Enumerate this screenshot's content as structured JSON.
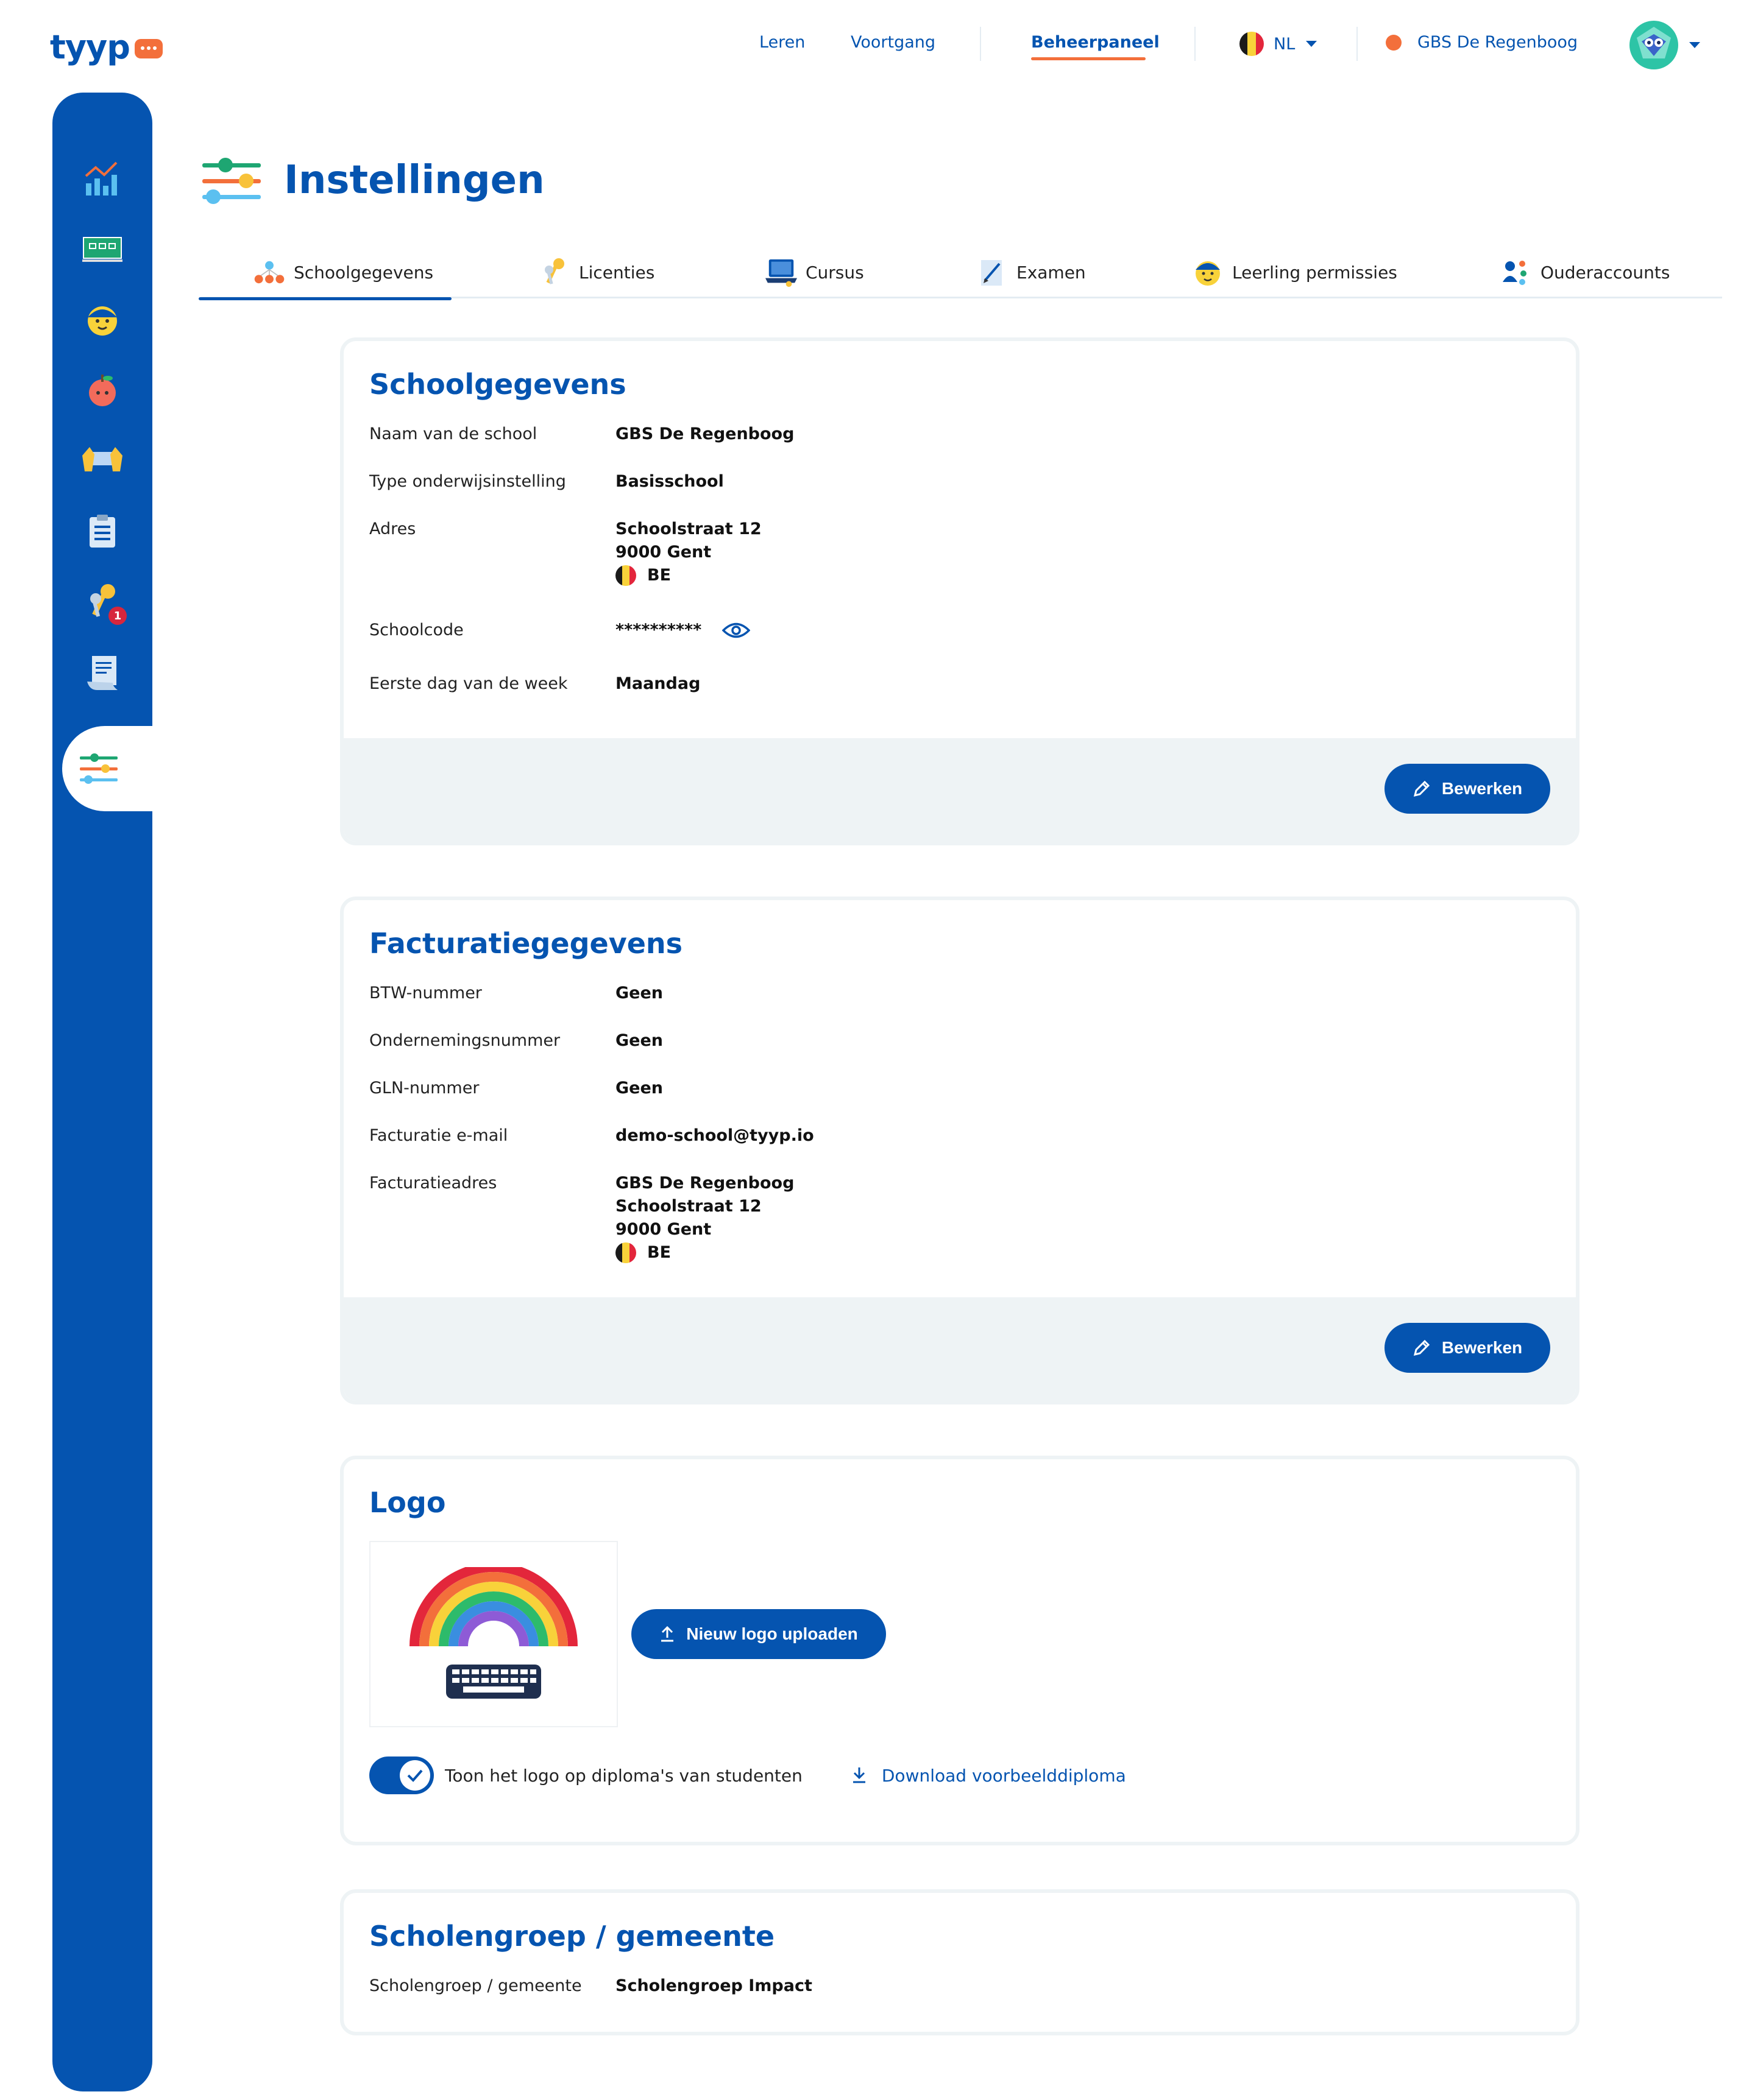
{
  "brand": {
    "name": "tyyp",
    "color": "#0554b0",
    "accent": "#f36f3b"
  },
  "topnav": {
    "links": [
      "Leren",
      "Voortgang",
      "Beheerpaneel"
    ],
    "active": "Beheerpaneel",
    "language": "NL",
    "school": "GBS De Regenboog"
  },
  "sidebar": {
    "items": [
      {
        "icon": "chart-icon"
      },
      {
        "icon": "classroom-board-icon"
      },
      {
        "icon": "student-icon"
      },
      {
        "icon": "apple-icon"
      },
      {
        "icon": "hands-keyboard-icon"
      },
      {
        "icon": "clipboard-icon"
      },
      {
        "icon": "keys-icon",
        "badge": "1"
      },
      {
        "icon": "certificate-icon"
      },
      {
        "icon": "settings-sliders-icon",
        "active": true
      }
    ]
  },
  "page": {
    "title": "Instellingen"
  },
  "tabs": [
    {
      "label": "Schoolgegevens",
      "icon": "hierarchy-icon",
      "active": true
    },
    {
      "label": "Licenties",
      "icon": "keys-icon"
    },
    {
      "label": "Cursus",
      "icon": "laptop-icon"
    },
    {
      "label": "Examen",
      "icon": "pencil-paper-icon"
    },
    {
      "label": "Leerling permissies",
      "icon": "student-icon"
    },
    {
      "label": "Ouderaccounts",
      "icon": "parents-icon"
    }
  ],
  "school": {
    "title": "Schoolgegevens",
    "rows": {
      "name": {
        "label": "Naam van de school",
        "value": "GBS De Regenboog"
      },
      "type": {
        "label": "Type onderwijsinstelling",
        "value": "Basisschool"
      },
      "address": {
        "label": "Adres",
        "line1": "Schoolstraat 12",
        "line2": "9000 Gent",
        "country": "BE"
      },
      "code": {
        "label": "Schoolcode",
        "value": "**********"
      },
      "firstday": {
        "label": "Eerste dag van de week",
        "value": "Maandag"
      }
    },
    "edit_label": "Bewerken"
  },
  "billing": {
    "title": "Facturatiegegevens",
    "rows": {
      "vat": {
        "label": "BTW-nummer",
        "value": "Geen"
      },
      "company": {
        "label": "Ondernemingsnummer",
        "value": "Geen"
      },
      "gln": {
        "label": "GLN-nummer",
        "value": "Geen"
      },
      "email": {
        "label": "Facturatie e-mail",
        "value": "demo-school@tyyp.io"
      },
      "address": {
        "label": "Facturatieadres",
        "line1": "GBS De Regenboog",
        "line2": "Schoolstraat 12",
        "line3": "9000 Gent",
        "country": "BE"
      }
    },
    "edit_label": "Bewerken"
  },
  "logo": {
    "title": "Logo",
    "upload_label": "Nieuw logo uploaden",
    "toggle_label": "Toon het logo op diploma's van studenten",
    "toggle_on": true,
    "download_label": "Download voorbeelddiploma"
  },
  "group": {
    "title": "Scholengroep / gemeente",
    "label": "Scholengroep / gemeente",
    "value": "Scholengroep Impact"
  },
  "colors": {
    "flag_black": "#1a1a1a",
    "flag_yellow": "#f8d23a",
    "flag_red": "#e3263b",
    "status_dot": "#f36f3b"
  }
}
